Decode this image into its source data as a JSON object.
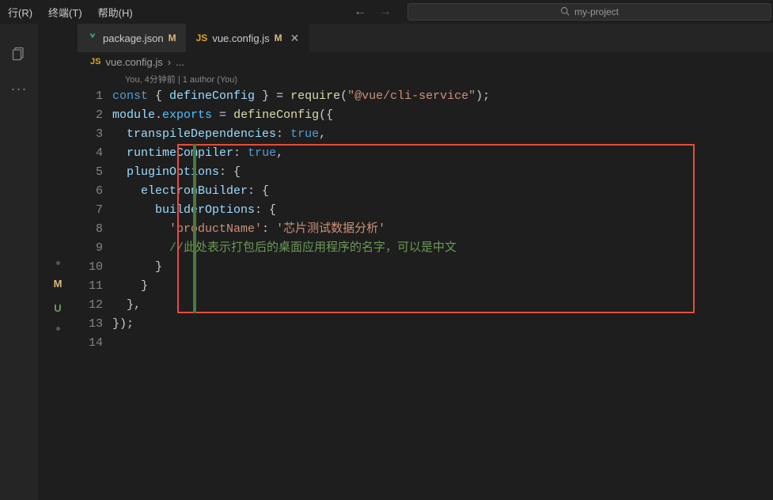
{
  "menu": {
    "run": "行(R)",
    "terminal": "终端(T)",
    "help": "帮助(H)"
  },
  "search": {
    "text": "my-project"
  },
  "tabs": {
    "pkg": {
      "label": "package.json",
      "status": "M"
    },
    "vcfg": {
      "label": "vue.config.js",
      "status": "M"
    }
  },
  "breadcrumb": {
    "file": "vue.config.js",
    "sep": "›",
    "more": "..."
  },
  "codelens": "You, 4分钟前 | 1 author (You)",
  "code": {
    "l1": {
      "const": "const",
      "lb": " { ",
      "dc": "defineConfig",
      "rb": " } = ",
      "req": "require",
      "lp": "(",
      "str": "\"@vue/cli-service\"",
      "rp": ");"
    },
    "l2": {
      "mod": "module",
      "dot": ".",
      "exp": "exports",
      "eq": " = ",
      "dc": "defineConfig",
      "lp": "({"
    },
    "l3": {
      "pad": "  ",
      "k": "transpileDependencies",
      "c": ": ",
      "v": "true",
      "e": ","
    },
    "l4": {
      "pad": "  ",
      "k": "runtimeCompiler",
      "c": ": ",
      "v": "true",
      "e": ","
    },
    "l5": {
      "pad": "  ",
      "k": "pluginOptions",
      "c": ": {"
    },
    "l6": {
      "pad": "    ",
      "k": "electronBuilder",
      "c": ": {"
    },
    "l7": {
      "pad": "      ",
      "k": "builderOptions",
      "c": ": {"
    },
    "l8": {
      "pad": "        ",
      "k": "'productName'",
      "c": ": ",
      "v": "'芯片测试数据分析'"
    },
    "l9": {
      "pad": "        ",
      "c": "//此处表示打包后的桌面应用程序的名字，可以是中文"
    },
    "l10": {
      "pad": "      ",
      "c": "}"
    },
    "l11": {
      "pad": "    ",
      "c": "}"
    },
    "l12": {
      "pad": "  ",
      "c": "},"
    },
    "l13": {
      "c": "});"
    }
  },
  "linenums": {
    "1": "1",
    "2": "2",
    "3": "3",
    "4": "4",
    "5": "5",
    "6": "6",
    "7": "7",
    "8": "8",
    "9": "9",
    "10": "10",
    "11": "11",
    "12": "12",
    "13": "13",
    "14": "14"
  },
  "side": {
    "m": "M",
    "u": "U"
  }
}
